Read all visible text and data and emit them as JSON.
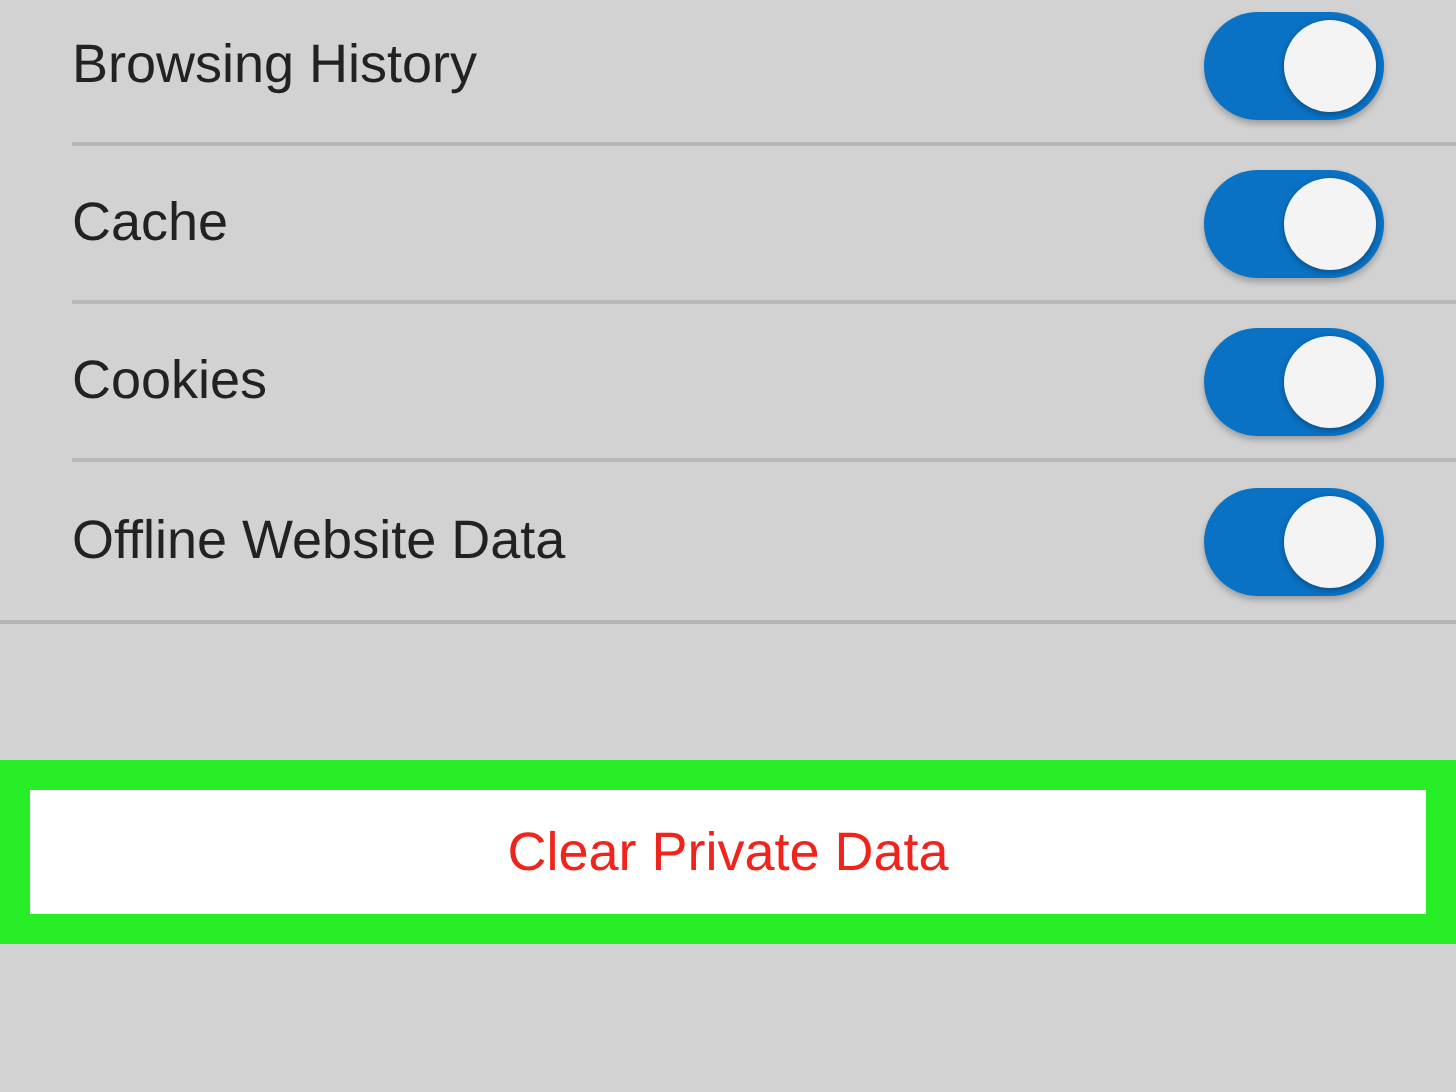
{
  "settings": [
    {
      "label": "Browsing History",
      "on": true
    },
    {
      "label": "Cache",
      "on": true
    },
    {
      "label": "Cookies",
      "on": true
    },
    {
      "label": "Offline Website Data",
      "on": true
    }
  ],
  "clear_button": {
    "label": "Clear Private Data",
    "highlighted": true
  }
}
